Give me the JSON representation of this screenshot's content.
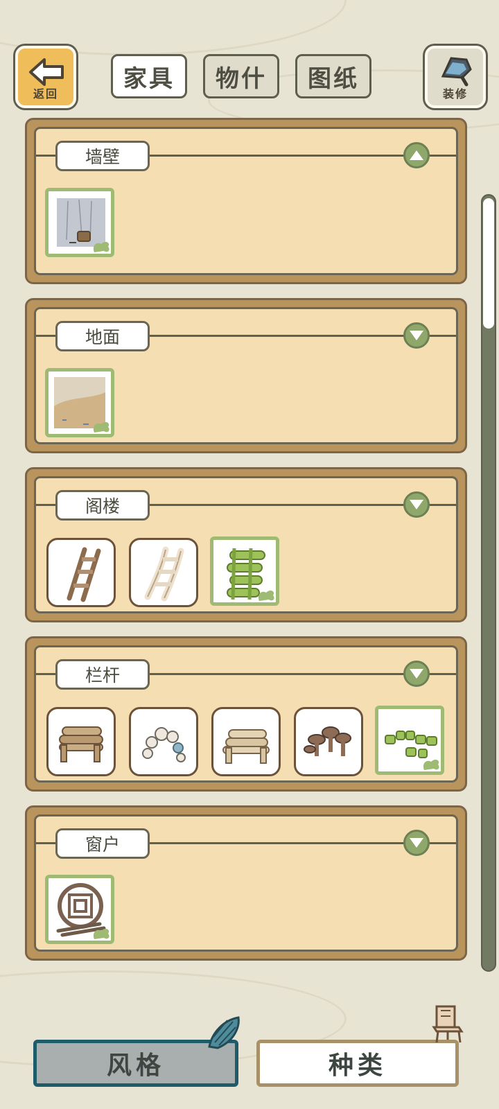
{
  "header": {
    "back_label": "返回",
    "decorate_label": "装修",
    "tabs": [
      {
        "label": "家具",
        "active": true
      },
      {
        "label": "物什",
        "active": false
      },
      {
        "label": "图纸",
        "active": false
      }
    ]
  },
  "sections": [
    {
      "label": "墙壁",
      "toggle": "collapse-up",
      "items": [
        "wall-stone-bucket"
      ],
      "selected_index": 0
    },
    {
      "label": "地面",
      "toggle": "expand-down",
      "items": [
        "floor-sand"
      ],
      "selected_index": 0
    },
    {
      "label": "阁楼",
      "toggle": "expand-down",
      "items": [
        "ladder-wood",
        "ladder-white",
        "ladder-bamboo"
      ],
      "selected_index": 2
    },
    {
      "label": "栏杆",
      "toggle": "expand-down",
      "items": [
        "rail-log-bench",
        "rail-stone-arch",
        "rail-light-log",
        "rail-mushrooms",
        "rail-bamboo-stumps"
      ],
      "selected_index": 4
    },
    {
      "label": "窗户",
      "toggle": "expand-down",
      "items": [
        "window-round-lattice"
      ],
      "selected_index": 0
    }
  ],
  "footer": {
    "style_label": "风格",
    "kind_label": "种类",
    "active": "style"
  },
  "colors": {
    "background": "#e8e4d3",
    "panel_wood": "#b9955d",
    "panel_fill": "#f5dfb2",
    "toggle_green": "#8fa76a",
    "selected_border": "#9fba73",
    "back_orange": "#f0bd5b",
    "style_border": "#1e5c6a"
  },
  "icons": [
    "back-arrow-icon",
    "brush-icon",
    "paw-icon",
    "shell-icon",
    "chair-icon",
    "chevron-up-icon",
    "chevron-down-icon"
  ]
}
